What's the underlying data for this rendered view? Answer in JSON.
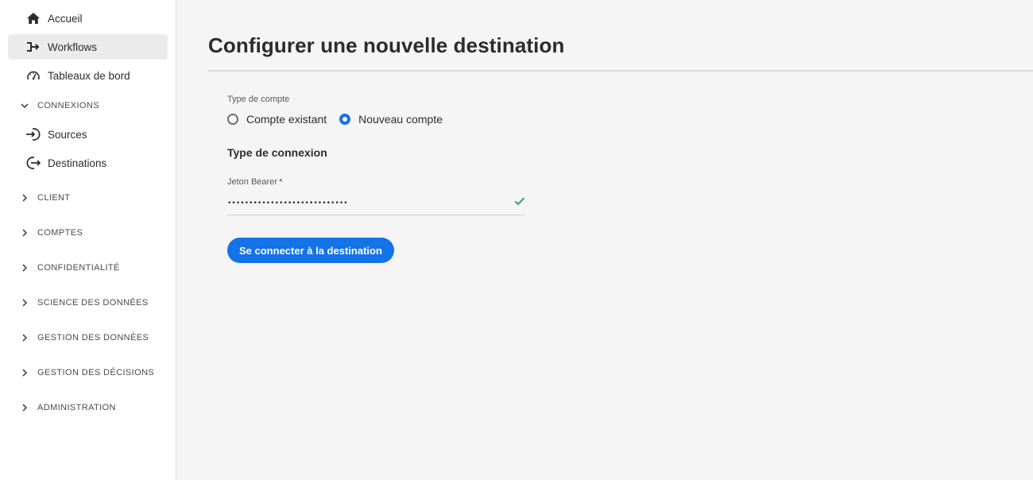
{
  "sidebar": {
    "items": [
      {
        "label": "Accueil",
        "icon": "home-icon"
      },
      {
        "label": "Workflows",
        "icon": "workflow-icon",
        "active": true
      },
      {
        "label": "Tableaux de bord",
        "icon": "dashboard-icon"
      }
    ],
    "connexions": {
      "label": "CONNEXIONS",
      "expanded": true,
      "items": [
        {
          "label": "Sources",
          "icon": "sources-icon"
        },
        {
          "label": "Destinations",
          "icon": "destinations-icon"
        }
      ]
    },
    "sections": [
      {
        "label": "CLIENT"
      },
      {
        "label": "COMPTES"
      },
      {
        "label": "CONFIDENTIALITÉ"
      },
      {
        "label": "SCIENCE DES DONNÉES"
      },
      {
        "label": "GESTION DES DONNÉES"
      },
      {
        "label": "GESTION DES DÉCISIONS"
      },
      {
        "label": "ADMINISTRATION"
      }
    ]
  },
  "main": {
    "title": "Configurer une nouvelle destination",
    "account_type_label": "Type de compte",
    "account_options": [
      {
        "label": "Compte existant",
        "selected": false
      },
      {
        "label": "Nouveau compte",
        "selected": true
      }
    ],
    "connection_type_heading": "Type de connexion",
    "token_label": "Jeton Bearer",
    "token_required_mark": "*",
    "token_value": "••••••••••••••••••••••••••••",
    "connect_button": "Se connecter à la destination"
  },
  "colors": {
    "accent": "#1473e6",
    "valid": "#2d9d78",
    "sidebar_active_bg": "#ebebeb",
    "main_bg": "#f5f5f5"
  }
}
